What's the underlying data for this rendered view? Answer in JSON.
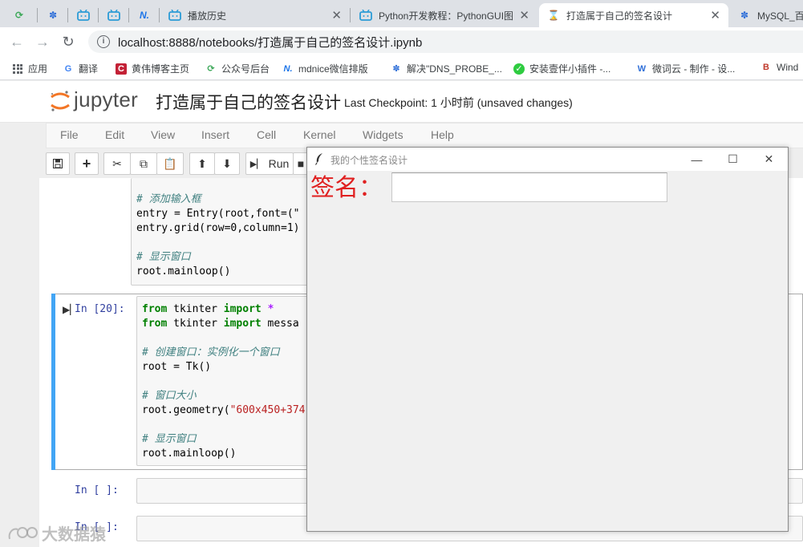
{
  "browser": {
    "tabs": [
      {
        "title": "",
        "icon": "refresh-icon"
      },
      {
        "title": "",
        "icon": "paw-icon"
      },
      {
        "title": "",
        "icon": "bilibili-icon"
      },
      {
        "title": "",
        "icon": "bilibili-icon"
      },
      {
        "title": "",
        "icon": "mdnice-icon"
      },
      {
        "title": "播放历史",
        "icon": "bilibili-icon"
      },
      {
        "title": "Python开发教程：PythonGUI图",
        "icon": "bilibili-icon"
      },
      {
        "title": "打造属于自己的签名设计",
        "icon": "hourglass-icon",
        "active": true
      },
      {
        "title": "MySQL_百",
        "icon": "paw-icon"
      }
    ],
    "close_glyph": "✕",
    "url": "localhost:8888/notebooks/打造属于自己的签名设计.ipynb",
    "bookmarks": [
      {
        "label": "应用",
        "icon": "apps-grid-icon"
      },
      {
        "label": "翻译",
        "icon": "translate-icon"
      },
      {
        "label": "黄伟博客主页",
        "icon": "csdn-icon"
      },
      {
        "label": "公众号后台",
        "icon": "wechat-icon"
      },
      {
        "label": "mdnice微信排版",
        "icon": "mdnice-icon"
      },
      {
        "label": "解决\"DNS_PROBE_...",
        "icon": "paw-icon"
      },
      {
        "label": "安装壹伴小插件 -...",
        "icon": "check-icon"
      },
      {
        "label": "微词云 - 制作 - 设...",
        "icon": "w-icon"
      },
      {
        "label": "Wind",
        "icon": "b-icon"
      }
    ]
  },
  "jupyter": {
    "brand": "jupyter",
    "notebook_name": "打造属于自己的签名设计",
    "checkpoint": "Last Checkpoint: 1 小时前   (unsaved changes)",
    "menu": [
      "File",
      "Edit",
      "View",
      "Insert",
      "Cell",
      "Kernel",
      "Widgets",
      "Help"
    ],
    "toolbar": {
      "run_label": "Run"
    },
    "cells": {
      "cell1_lines": [
        {
          "cls": "cm-comment",
          "text": "# 添加输入框"
        },
        {
          "cls": "",
          "text": "entry = Entry(root,font=(\""
        },
        {
          "cls": "",
          "text": "entry.grid(row=0,column=1)"
        },
        {
          "cls": "",
          "text": ""
        },
        {
          "cls": "cm-comment",
          "text": "# 显示窗口"
        },
        {
          "cls": "",
          "text": "root.mainloop()"
        }
      ],
      "cell2_prompt": "In  [20]:",
      "cell3_prompt": "In  [  ]:",
      "cell4_prompt": "In  [  ]:"
    }
  },
  "tk_window": {
    "title": "我的个性签名设计",
    "minimize": "—",
    "maximize": "☐",
    "close": "✕",
    "label": "签名：",
    "entry_value": ""
  },
  "watermark": "大数据猿",
  "colors": {
    "label_red": "#e02020",
    "cell_selected": "#42a5f5",
    "jupyter_orange": "#f37626"
  }
}
